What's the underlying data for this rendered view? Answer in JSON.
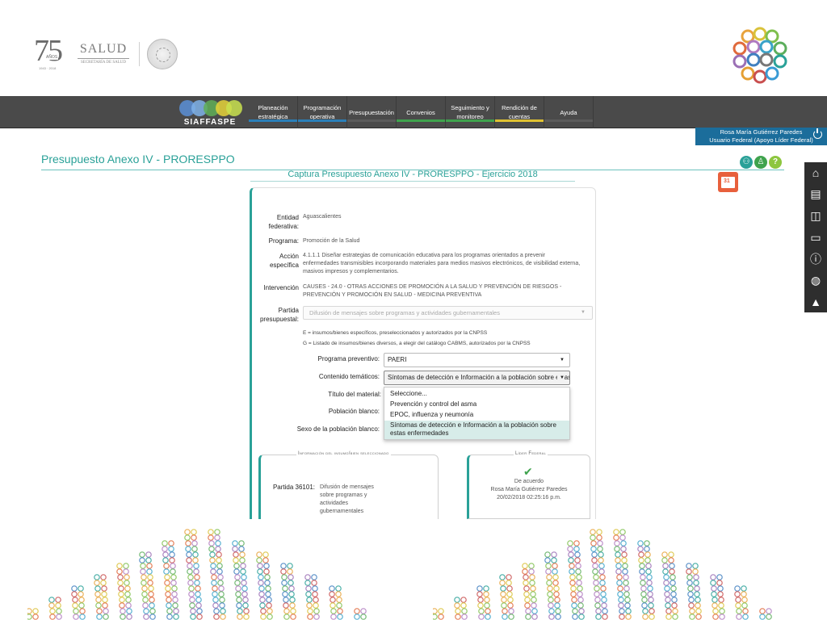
{
  "header": {
    "logo_75_number": "75",
    "logo_75_anos": "AÑOS",
    "logo_75_years": "1943 · 2018",
    "salud_title": "SALUD",
    "salud_subtitle": "SECRETARÍA DE SALUD"
  },
  "nav": {
    "brand": "SIAFFASPE",
    "items": [
      {
        "label": "Planeación estratégica",
        "color": "#2a7fb8"
      },
      {
        "label": "Programación operativa",
        "color": "#2a7fb8"
      },
      {
        "label": "Presupuestación",
        "color": "#5b5b5b"
      },
      {
        "label": "Convenios",
        "color": "#3fa34d"
      },
      {
        "label": "Seguimiento y monitoreo",
        "color": "#3fa34d"
      },
      {
        "label": "Rendición de cuentas",
        "color": "#e0c232"
      },
      {
        "label": "Ayuda",
        "color": "#5b5b5b"
      }
    ]
  },
  "user": {
    "name": "Rosa María Gutiérrez Paredes",
    "role": "Usuario Federal (Apoyo Líder Federal)"
  },
  "page": {
    "title": "Presupuesto Anexo IV - PRORESPPO",
    "subtitle": "Captura Presupuesto Anexo IV - PRORESPPO - Ejercicio 2018"
  },
  "form": {
    "entidad_label": "Entidad federativa:",
    "entidad_value": "Aguascalientes",
    "programa_label": "Programa:",
    "programa_value": "Promoción de la Salud",
    "accion_label": "Acción específica",
    "accion_value": "4.1.1.1 Diseñar estrategias de comunicación educativa para los programas orientados a prevenir enfermedades transmisibles incorporando materiales para medios masivos electrónicos, de visibilidad externa, masivos impresos y complementarios.",
    "intervencion_label": "Intervención",
    "intervencion_value": "CAUSES - 24.0 - OTRAS ACCIONES DE PROMOCIÓN A LA SALUD Y PREVENCIÓN DE RIESGOS - PREVENCIÓN Y PROMOCIÓN EN SALUD - MEDICINA PREVENTIVA",
    "partida_label": "Partida presupuestal:",
    "partida_value": "Difusión de mensajes sobre programas y actividades gubernamentales",
    "note_e": "E = insumos/bienes específicos, preseleccionados y autorizados por la CNPSS",
    "note_g": "G = Listado de insumos/bienes diversos, a elegir del catálogo CABMS, autorizados por la CNPSS",
    "programa_prev_label": "Programa preventivo:",
    "programa_prev_value": "PAERI",
    "contenido_label": "Contenido temáticos:",
    "contenido_value": "Síntomas de detección e Información a la población sobre estas enfermedades",
    "titulo_label": "Título del material:",
    "poblacion_label": "Población blanco:",
    "sexo_label": "Sexo de la población blanco:",
    "dropdown_options": [
      "Seleccione...",
      "Prevención y control del asma",
      "EPOC, influenza y neumonía",
      "Síntomas de detección e Información a la población sobre estas enfermedades"
    ]
  },
  "info_box": {
    "legend": "Información del insumo/bien seleccionado",
    "partida_label": "Partida 36101:",
    "partida_desc": "Difusión de mensajes sobre programas y actividades gubernamentales"
  },
  "lider_box": {
    "legend": "Líder Federal",
    "status": "De acuerdo",
    "name": "Rosa María Gutiérrez Paredes",
    "datetime": "20/02/2018 02:25:16 p.m."
  },
  "colors": {
    "accent": "#2aa198",
    "navbar": "#4a4a4a",
    "user_box": "#1b6d9b",
    "calendar": "#e8603c"
  },
  "icons": {
    "side_bar": [
      "home-icon",
      "list-icon",
      "cube-icon",
      "truck-icon",
      "info-icon",
      "chart-icon",
      "graduation-cap-icon"
    ],
    "round": [
      "people-icon",
      "user-icon",
      "help-icon"
    ]
  }
}
